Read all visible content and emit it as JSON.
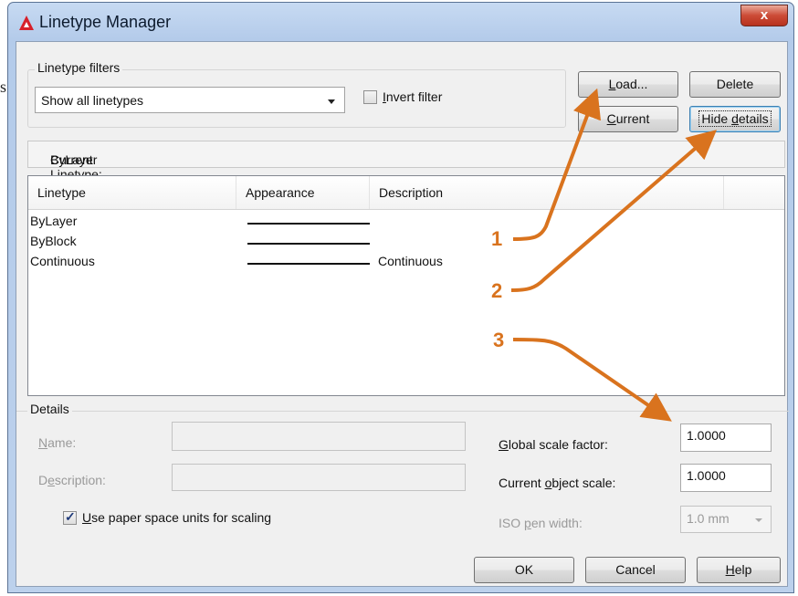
{
  "background_fragment": "s",
  "window": {
    "title": "Linetype Manager",
    "close_glyph": "x",
    "icon": "autocad-logo-icon"
  },
  "filters": {
    "group_label": "Linetype filters",
    "selected": "Show all linetypes",
    "invert_label": "Invert filter",
    "invert_checked": false
  },
  "buttons": {
    "load": "Load...",
    "delete": "Delete",
    "current": "Current",
    "hide_details": "Hide details"
  },
  "current_linetype": {
    "label": "Current Linetype:",
    "value": "ByLayer"
  },
  "table": {
    "headers": [
      "Linetype",
      "Appearance",
      "Description"
    ],
    "rows": [
      {
        "linetype": "ByLayer",
        "description": ""
      },
      {
        "linetype": "ByBlock",
        "description": ""
      },
      {
        "linetype": "Continuous",
        "description": "Continuous"
      }
    ]
  },
  "details": {
    "group_label": "Details",
    "name_label": "Name:",
    "name_value": "",
    "description_label": "Description:",
    "description_value": "",
    "paper_space_label": "Use paper space units for scaling",
    "paper_space_checked": true,
    "global_scale_label": "Global scale factor:",
    "global_scale_value": "1.0000",
    "object_scale_label": "Current object scale:",
    "object_scale_value": "1.0000",
    "iso_label": "ISO pen width:",
    "iso_value": "1.0 mm"
  },
  "footer": {
    "ok": "OK",
    "cancel": "Cancel",
    "help": "Help"
  },
  "callouts": [
    "1",
    "2",
    "3"
  ],
  "colors": {
    "callout_orange": "#d9731e",
    "title_gradient": "#c7daf2",
    "close_red": "#cc4b36"
  }
}
